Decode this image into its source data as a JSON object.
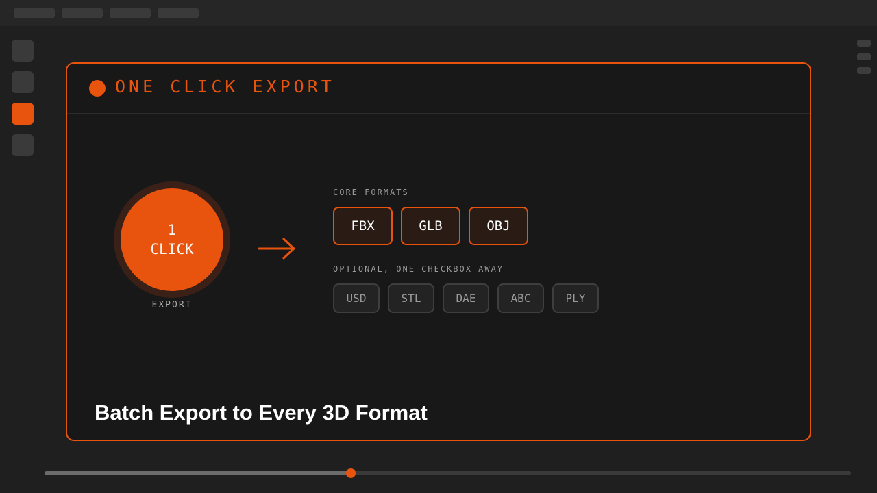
{
  "top_tabs": [
    "",
    "",
    "",
    ""
  ],
  "left_rail": {
    "active_index": 2
  },
  "card": {
    "title": "ONE CLICK EXPORT",
    "big_button": {
      "line1": "1",
      "line2": "CLICK",
      "caption": "EXPORT"
    },
    "core_label": "CORE FORMATS",
    "core_formats": [
      "FBX",
      "GLB",
      "OBJ"
    ],
    "optional_label": "OPTIONAL, ONE CHECKBOX AWAY",
    "optional_formats": [
      "USD",
      "STL",
      "DAE",
      "ABC",
      "PLY"
    ],
    "footer_title": "Batch Export to Every 3D Format"
  },
  "timeline": {
    "progress": 0.38
  },
  "colors": {
    "accent": "#e8530e",
    "background": "#1f1f1f",
    "card": "#181818"
  },
  "icons": {
    "header": "record-dot-icon",
    "arrow": "arrow-right-icon"
  }
}
